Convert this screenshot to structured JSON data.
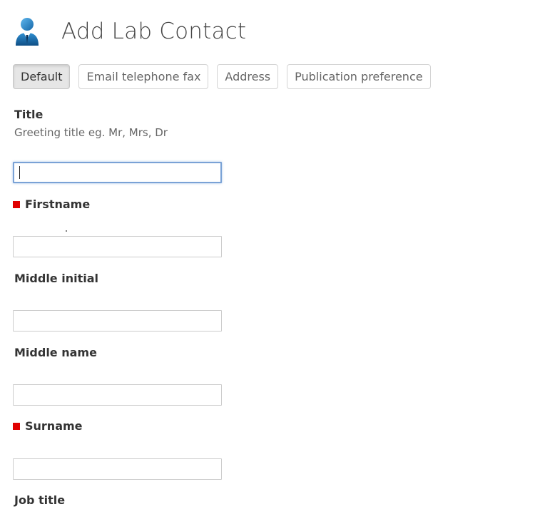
{
  "header": {
    "title": "Add Lab Contact",
    "icon": "user-contact-icon"
  },
  "tabs": [
    {
      "label": "Default",
      "active": true
    },
    {
      "label": "Email telephone fax",
      "active": false
    },
    {
      "label": "Address",
      "active": false
    },
    {
      "label": "Publication preference",
      "active": false
    }
  ],
  "form": {
    "title": {
      "label": "Title",
      "help": "Greeting title eg. Mr, Mrs, Dr",
      "value": ""
    },
    "firstname": {
      "label": "Firstname",
      "required": true,
      "value": ""
    },
    "middle_initial": {
      "label": "Middle initial",
      "value": ""
    },
    "middle_name": {
      "label": "Middle name",
      "value": ""
    },
    "surname": {
      "label": "Surname",
      "required": true,
      "value": ""
    },
    "job_title": {
      "label": "Job title"
    }
  },
  "colors": {
    "required_marker": "#e00000",
    "focus_border": "#7aa2d6",
    "icon_blue": "#1f7fc4"
  }
}
